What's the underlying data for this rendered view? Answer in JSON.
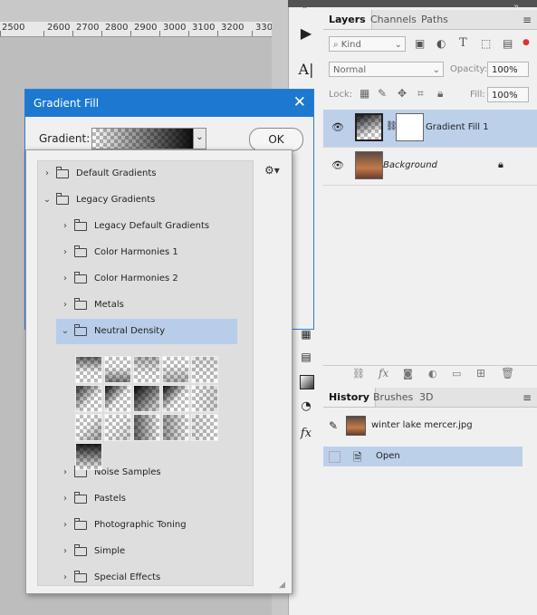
{
  "ruler": {
    "labels": [
      "2500",
      "2600",
      "2700",
      "2800",
      "2900",
      "3000",
      "3100",
      "3200",
      "330"
    ]
  },
  "layers_panel": {
    "tabs": [
      "Layers",
      "Channels",
      "Paths"
    ],
    "kind_placeholder": "Kind",
    "blend_mode": "Normal",
    "opacity_label": "Opacity:",
    "opacity_value": "100%",
    "lock_label": "Lock:",
    "fill_label": "Fill:",
    "fill_value": "100%",
    "layers": [
      {
        "name": "Gradient Fill 1",
        "selected": true,
        "visible": true
      },
      {
        "name": "Background",
        "selected": false,
        "visible": true,
        "locked": true
      }
    ],
    "footer_icons": [
      "link-icon",
      "fx-icon",
      "mask-icon",
      "adjustment-icon",
      "folder-icon",
      "new-layer-icon",
      "trash-icon"
    ]
  },
  "history_panel": {
    "tabs": [
      "History",
      "Brushes",
      "3D"
    ],
    "snapshot_name": "winter lake mercer.jpg",
    "steps": [
      {
        "name": "Open",
        "selected": true
      }
    ]
  },
  "dialog": {
    "title": "Gradient Fill",
    "close_glyph": "✕",
    "gradient_label": "Gradient:",
    "ok_label": "OK"
  },
  "gradient_popup": {
    "tree": [
      {
        "label": "Default Gradients",
        "level": 0,
        "expanded": false
      },
      {
        "label": "Legacy Gradients",
        "level": 0,
        "expanded": true
      },
      {
        "label": "Legacy Default Gradients",
        "level": 1,
        "expanded": false
      },
      {
        "label": "Color Harmonies 1",
        "level": 1,
        "expanded": false
      },
      {
        "label": "Color Harmonies 2",
        "level": 1,
        "expanded": false
      },
      {
        "label": "Metals",
        "level": 1,
        "expanded": false
      },
      {
        "label": "Neutral Density",
        "level": 1,
        "expanded": true,
        "selected": true
      },
      {
        "label": "Noise Samples",
        "level": 1,
        "expanded": false
      },
      {
        "label": "Pastels",
        "level": 1,
        "expanded": false
      },
      {
        "label": "Photographic Toning",
        "level": 1,
        "expanded": false
      },
      {
        "label": "Simple",
        "level": 1,
        "expanded": false
      },
      {
        "label": "Special Effects",
        "level": 1,
        "expanded": false
      }
    ],
    "swatch_count": 16
  },
  "colors": {
    "title_bar": "#1d79d0",
    "selection": "#b8cde9",
    "panel_bg": "#f0f0f0"
  }
}
